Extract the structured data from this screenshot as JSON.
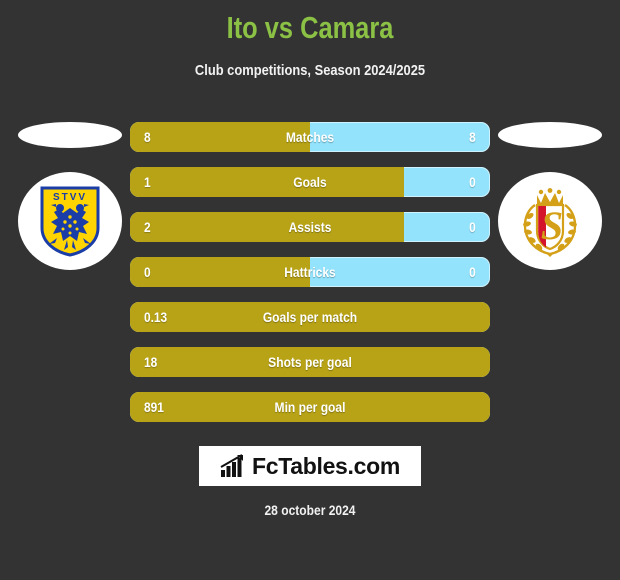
{
  "header": {
    "title": "Ito vs Camara",
    "subtitle": "Club competitions, Season 2024/2025",
    "title_color": "#8BC144"
  },
  "theme": {
    "background": "#333333",
    "home_bar_color": "#B8A317",
    "away_bar_color": "#93E3FC",
    "text_color": "#FFFFFF"
  },
  "teams": {
    "home": {
      "name": "STVV",
      "crest_icon": "stvv-crest-icon",
      "crest_text": "STVV",
      "crest_colors": {
        "field": "#FFD400",
        "charge": "#1A3DA8",
        "border": "#1A3DA8"
      }
    },
    "away": {
      "name": "Standard Liege",
      "crest_icon": "standard-liege-crest-icon",
      "crest_text": "S",
      "crest_colors": {
        "field": "#FFFFFF",
        "stripe": "#D3142B",
        "charge": "#D4A017"
      }
    }
  },
  "chart_data": {
    "type": "bar",
    "title": "Ito vs Camara",
    "subtitle": "Club competitions, Season 2024/2025",
    "orientation": "horizontal-diverging",
    "series": [
      {
        "name": "Ito",
        "color": "#B8A317"
      },
      {
        "name": "Camara",
        "color": "#93E3FC"
      }
    ],
    "categories": [
      "Matches",
      "Goals",
      "Assists",
      "Hattricks",
      "Goals per match",
      "Shots per goal",
      "Min per goal"
    ],
    "rows": [
      {
        "label": "Matches",
        "home_value": "8",
        "away_value": "8",
        "home_pct": 50,
        "away_pct": 50,
        "split": true
      },
      {
        "label": "Goals",
        "home_value": "1",
        "away_value": "0",
        "home_pct": 76,
        "away_pct": 24,
        "split": true
      },
      {
        "label": "Assists",
        "home_value": "2",
        "away_value": "0",
        "home_pct": 76,
        "away_pct": 24,
        "split": true
      },
      {
        "label": "Hattricks",
        "home_value": "0",
        "away_value": "0",
        "home_pct": 50,
        "away_pct": 50,
        "split": true
      },
      {
        "label": "Goals per match",
        "home_value": "0.13",
        "away_value": "",
        "home_pct": 100,
        "away_pct": 0,
        "split": false
      },
      {
        "label": "Shots per goal",
        "home_value": "18",
        "away_value": "",
        "home_pct": 100,
        "away_pct": 0,
        "split": false
      },
      {
        "label": "Min per goal",
        "home_value": "891",
        "away_value": "",
        "home_pct": 100,
        "away_pct": 0,
        "split": false
      }
    ]
  },
  "footer": {
    "brand": "FcTables.com",
    "brand_icon": "bar-chart-icon",
    "date": "28 october 2024"
  }
}
